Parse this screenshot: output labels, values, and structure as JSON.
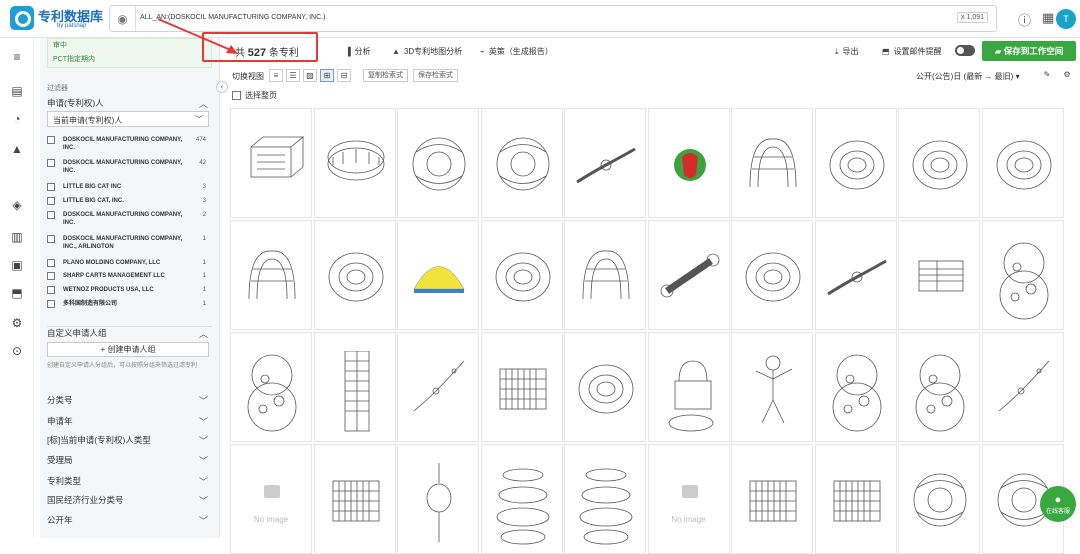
{
  "app": {
    "name": "专利数据库",
    "sub": "by patsnap"
  },
  "search": {
    "query": "ALL_AN:(DOSKOCIL MANUFACTURING COMPANY, INC.)",
    "count": "x 1,091",
    "globe_icon": "globe-icon"
  },
  "user": {
    "initial": "T"
  },
  "sidebar": {
    "pct_line1": "审中",
    "pct_line2": "PCT指定期内",
    "filter_label": "过滤器",
    "applicant_section": "申请(专利权)人",
    "dropdown": "当前申请(专利权)人",
    "applicants": [
      {
        "name": "DOSKOCIL MANUFACTURING COMPANY, INC.",
        "count": "474"
      },
      {
        "name": "DOSKOCIL MANUFACTURING COMPANY, INC.",
        "count": "42"
      },
      {
        "name": "LITTLE BIG CAT INC",
        "count": "3"
      },
      {
        "name": "LITTLE BIG CAT, INC.",
        "count": "3"
      },
      {
        "name": "DOSKOCIL MANUFACTURING COMPANY, INC.",
        "count": "2"
      },
      {
        "name": "DOSKOCIL MANUFACTURING COMPANY, INC., ARLINGTON",
        "count": "1"
      },
      {
        "name": "PLANO MOLDING COMPANY, LLC",
        "count": "1"
      },
      {
        "name": "SHARP CARTS MANAGEMENT LLC",
        "count": "1"
      },
      {
        "name": "WETNOZ PRODUCTS USA, LLC",
        "count": "1"
      },
      {
        "name": "多科国制造有限公司",
        "count": "1"
      }
    ],
    "custom_group": "自定义申请人组",
    "create_group": "+ 创建申请人组",
    "hint": "创建自定义申请人分组后，可以按照分组来筛选过滤专利",
    "sections": [
      "分类号",
      "申请年",
      "[标]当前申请(专利权)人类型",
      "受理局",
      "专利类型",
      "国民经济行业分类号",
      "公开年"
    ]
  },
  "toolbar": {
    "result_prefix": "共",
    "result_count": "527",
    "result_suffix": "条专利",
    "analyze": "分析",
    "map3d": "3D专利地图分析",
    "report": "英策（生成报告）",
    "export": "导出",
    "alert": "设置邮件提醒",
    "save": "保存到工作空间"
  },
  "viewbar": {
    "label": "切换视图",
    "copy_search": "复制检索式",
    "save_search": "保存检索式",
    "sort": "公开(公告)日 (最新 → 最旧)",
    "select_page": "选择整页"
  },
  "grid": {
    "no_image": "No image"
  },
  "chat": {
    "label": "在线客服"
  },
  "colors": {
    "accent": "#3aa840",
    "brand": "#1e9ed6",
    "highlight": "#e53935"
  }
}
